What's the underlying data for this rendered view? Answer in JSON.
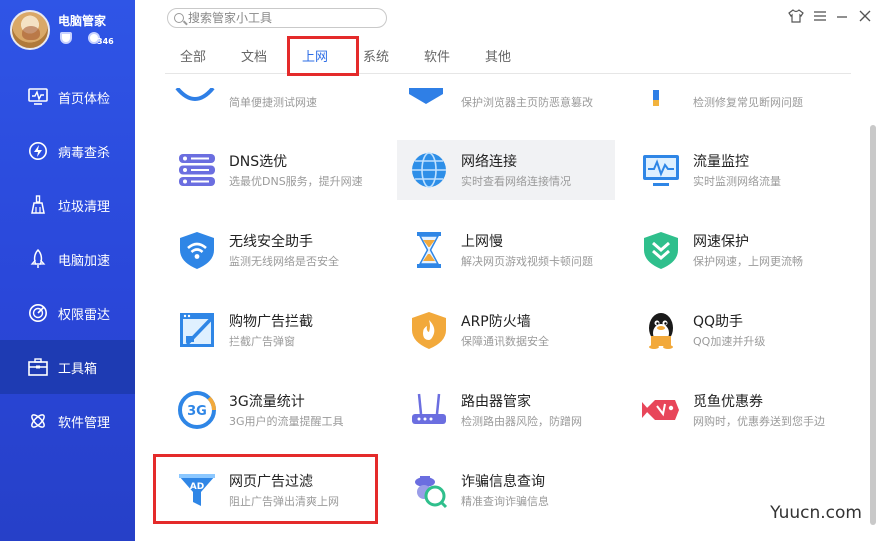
{
  "profile": {
    "name": "电脑管家",
    "badge": "346"
  },
  "sidebar": {
    "items": [
      {
        "label": "首页体检",
        "icon": "monitor-icon"
      },
      {
        "label": "病毒查杀",
        "icon": "lightning-icon"
      },
      {
        "label": "垃圾清理",
        "icon": "broom-icon"
      },
      {
        "label": "电脑加速",
        "icon": "rocket-icon"
      },
      {
        "label": "权限雷达",
        "icon": "radar-icon"
      },
      {
        "label": "工具箱",
        "icon": "toolbox-icon",
        "active": true
      },
      {
        "label": "软件管理",
        "icon": "apps-icon"
      }
    ]
  },
  "search": {
    "placeholder": "搜索管家小工具"
  },
  "tabs": [
    "全部",
    "文档",
    "上网",
    "系统",
    "软件",
    "其他"
  ],
  "active_tab": "上网",
  "partial_row": [
    "简单便捷测试网速",
    "保护浏览器主页防恶意篡改",
    "检测修复常见断网问题"
  ],
  "tools": [
    {
      "name": "DNS选优",
      "desc": "选最优DNS服务，提升网速",
      "icon": "dns-server-icon"
    },
    {
      "name": "网络连接",
      "desc": "实时查看网络连接情况",
      "icon": "globe-icon"
    },
    {
      "name": "流量监控",
      "desc": "实时监测网络流量",
      "icon": "traffic-monitor-icon"
    },
    {
      "name": "无线安全助手",
      "desc": "监测无线网络是否安全",
      "icon": "wifi-shield-icon"
    },
    {
      "name": "上网慢",
      "desc": "解决网页游戏视频卡顿问题",
      "icon": "hourglass-icon"
    },
    {
      "name": "网速保护",
      "desc": "保护网速，上网更流畅",
      "icon": "speed-shield-icon"
    },
    {
      "name": "购物广告拦截",
      "desc": "拦截广告弹窗",
      "icon": "ad-block-icon"
    },
    {
      "name": "ARP防火墙",
      "desc": "保障通讯数据安全",
      "icon": "firewall-icon"
    },
    {
      "name": "QQ助手",
      "desc": "QQ加速并升级",
      "icon": "qq-penguin-icon"
    },
    {
      "name": "3G流量统计",
      "desc": "3G用户的流量提醒工具",
      "icon": "3g-icon"
    },
    {
      "name": "路由器管家",
      "desc": "检测路由器风险，防蹭网",
      "icon": "router-icon"
    },
    {
      "name": "觅鱼优惠券",
      "desc": "网购时，优惠券送到您手边",
      "icon": "coupon-fish-icon"
    },
    {
      "name": "网页广告过滤",
      "desc": "阻止广告弹出清爽上网",
      "icon": "ad-filter-icon"
    },
    {
      "name": "诈骗信息查询",
      "desc": "精准查询诈骗信息",
      "icon": "fraud-search-icon"
    }
  ],
  "watermark": "Yuucn.com",
  "colors": {
    "sidebar": "#2f55e6",
    "accent": "#2f6fe6",
    "highlight": "#e42a2a"
  }
}
